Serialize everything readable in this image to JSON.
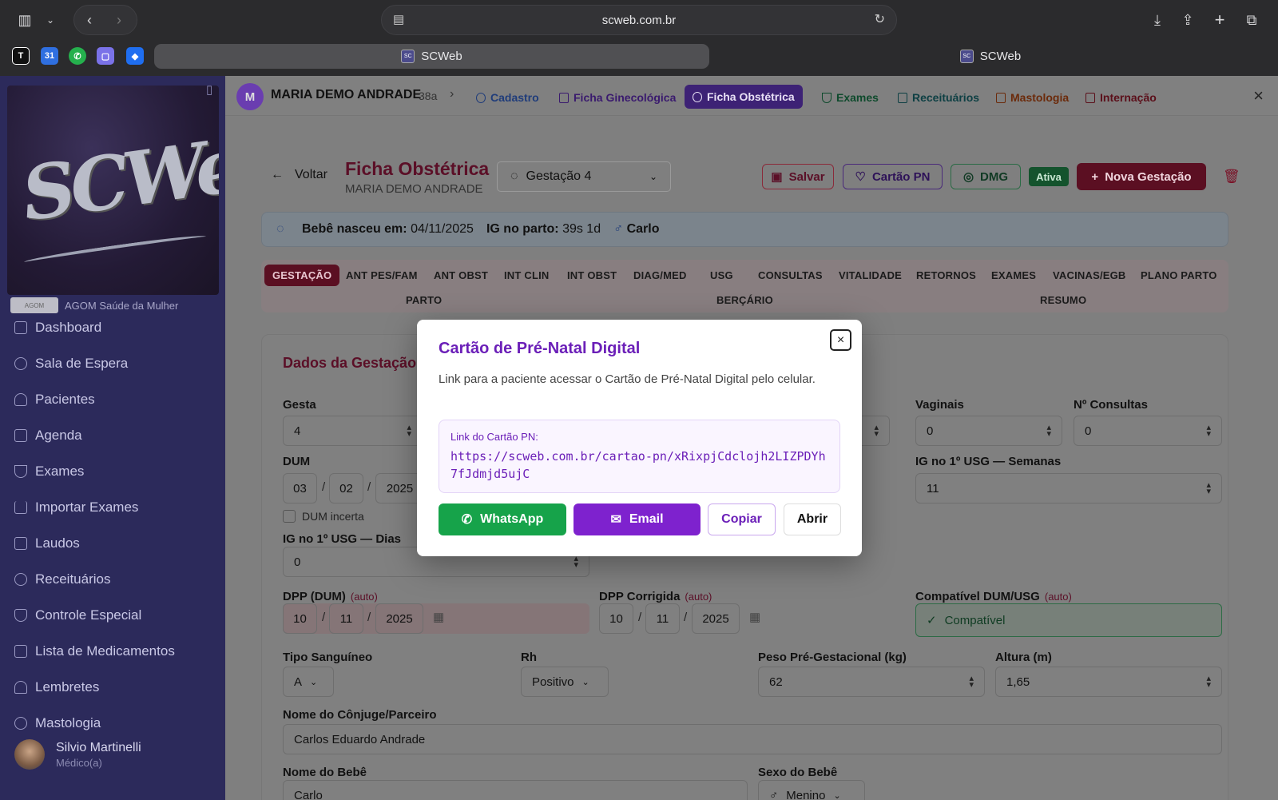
{
  "browser": {
    "url": "scweb.com.br",
    "tabs": [
      {
        "label": "SCWeb"
      },
      {
        "label": "SCWeb"
      }
    ]
  },
  "sidebar": {
    "logo_text": "SCWeb",
    "org_name": "AGOM Saúde da Mulher",
    "items": [
      {
        "label": "Dashboard",
        "icon": "grid-icon"
      },
      {
        "label": "Sala de Espera",
        "icon": "clock-icon"
      },
      {
        "label": "Pacientes",
        "icon": "users-icon"
      },
      {
        "label": "Agenda",
        "icon": "calendar-icon"
      },
      {
        "label": "Exames",
        "icon": "flask-icon"
      },
      {
        "label": "Importar Exames",
        "icon": "upload-icon"
      },
      {
        "label": "Laudos",
        "icon": "clipboard-icon"
      },
      {
        "label": "Receituários",
        "icon": "pill-icon"
      },
      {
        "label": "Controle Especial",
        "icon": "shield-icon"
      },
      {
        "label": "Lista de Medicamentos",
        "icon": "book-icon"
      },
      {
        "label": "Lembretes",
        "icon": "bell-icon"
      },
      {
        "label": "Mastologia",
        "icon": "ribbon-icon"
      }
    ],
    "user": {
      "name": "Silvio Martinelli",
      "role": "Médico(a)"
    }
  },
  "patient_nav": {
    "initial": "M",
    "name": "MARIA DEMO ANDRADE",
    "age": "38a",
    "tabs": [
      {
        "label": "Cadastro",
        "color": "#1f3c7a"
      },
      {
        "label": "Ficha Ginecológica",
        "color": "#3a1a6e"
      },
      {
        "label": "Ficha Obstétrica",
        "color": "#ffffff"
      },
      {
        "label": "Exames",
        "color": "#0e4a2c"
      },
      {
        "label": "Receituários",
        "color": "#0d3f43"
      },
      {
        "label": "Mastologia",
        "color": "#6b2a0a"
      },
      {
        "label": "Internação",
        "color": "#5b0f1a"
      }
    ]
  },
  "header": {
    "back_label": "Voltar",
    "title": "Ficha Obstétrica",
    "subtitle": "MARIA DEMO ANDRADE",
    "gestation_select": "Gestação 4",
    "save_label": "Salvar",
    "cartao_label": "Cartão PN",
    "dmg_label": "DMG",
    "active_badge": "Ativa",
    "new_label": "Nova Gestação"
  },
  "birth_info": {
    "born_label": "Bebê nasceu em:",
    "born_date": "04/11/2025",
    "ig_label": "IG no parto:",
    "ig_value": "39s 1d",
    "baby_name": "Carlo"
  },
  "steps": [
    "GESTAÇÃO",
    "ANT PES/FAM",
    "ANT OBST",
    "INT CLIN",
    "INT OBST",
    "DIAG/MED",
    "USG",
    "CONSULTAS",
    "VITALIDADE",
    "RETORNOS",
    "EXAMES",
    "VACINAS/EGB",
    "PLANO PARTO",
    "PARTO",
    "BERÇÁRIO",
    "RESUMO"
  ],
  "form": {
    "section_title": "Dados da Gestação",
    "gesta_label": "Gesta",
    "gesta_value": "4",
    "vaginais_label": "Vaginais",
    "vaginais_value": "0",
    "consultas_label": "Nº Consultas",
    "consultas_value": "0",
    "dum_label": "DUM",
    "dum_day": "03",
    "dum_month": "02",
    "dum_year": "2025",
    "dum_uncertain": "DUM incerta",
    "ig_usg_weeks_label": "IG no 1º USG — Semanas",
    "ig_usg_weeks_value": "11",
    "ig_usg_days_label": "IG no 1º USG — Dias",
    "ig_usg_days_value": "0",
    "dpp_label": "DPP (DUM)",
    "auto": "(auto)",
    "dpp_day": "10",
    "dpp_month": "11",
    "dpp_year": "2025",
    "dppc_label": "DPP Corrigida",
    "dppc_day": "10",
    "dppc_month": "11",
    "dppc_year": "2025",
    "compat_label": "Compatível DUM/USG",
    "compat_value": "Compatível",
    "blood_label": "Tipo Sanguíneo",
    "blood_value": "A",
    "rh_label": "Rh",
    "rh_value": "Positivo",
    "weight_label": "Peso Pré-Gestacional (kg)",
    "weight_value": "62",
    "height_label": "Altura (m)",
    "height_value": "1,65",
    "partner_label": "Nome do Cônjuge/Parceiro",
    "partner_value": "Carlos Eduardo Andrade",
    "baby_label": "Nome do Bebê",
    "baby_value": "Carlo",
    "sex_label": "Sexo do Bebê",
    "sex_value": "Menino"
  },
  "modal": {
    "title": "Cartão de Pré-Natal Digital",
    "description": "Link para a paciente acessar o Cartão de Pré-Natal Digital pelo celular.",
    "link_label": "Link do Cartão PN:",
    "link_value": "https://scweb.com.br/cartao-pn/xRixpjCdclojh2LIZPDYh7fJdmjd5ujC",
    "whatsapp_label": "WhatsApp",
    "email_label": "Email",
    "copy_label": "Copiar",
    "open_label": "Abrir"
  },
  "colors": {
    "accent": "#6b1fb8",
    "whatsapp": "#16a34a",
    "brand_red": "#c8194d",
    "sidebar": "#2c2a5b"
  }
}
